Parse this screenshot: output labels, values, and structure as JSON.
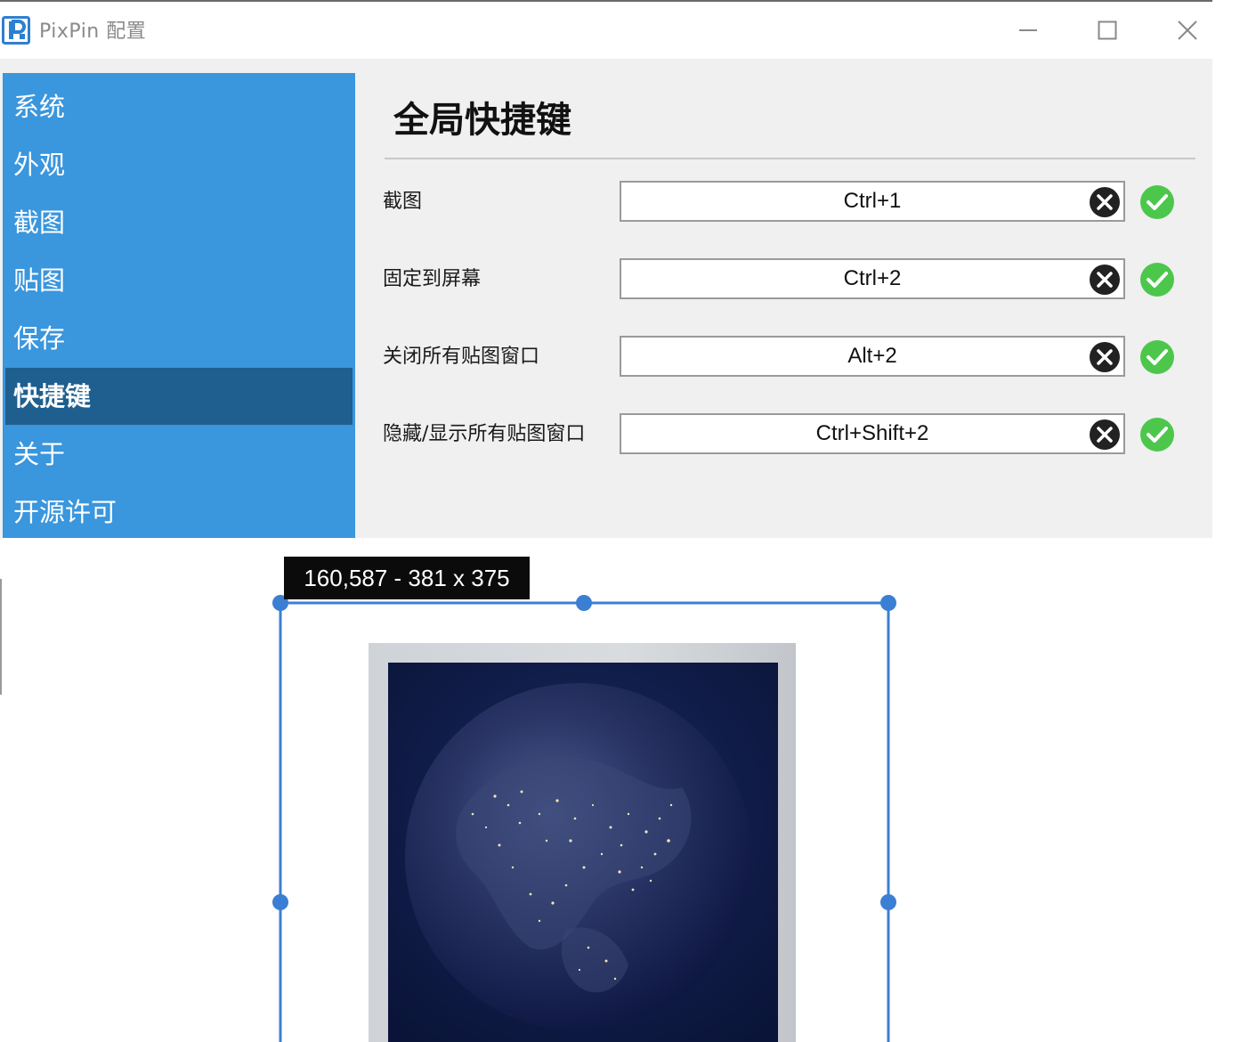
{
  "window": {
    "title": "PixPin 配置",
    "icon": "pixpin-logo-icon",
    "controls": {
      "minimize": "minimize-icon",
      "maximize": "maximize-icon",
      "close": "close-icon"
    }
  },
  "sidebar": {
    "accent_color": "#3a96dd",
    "active_color": "#1e5f8f",
    "items": [
      {
        "label": "系统",
        "active": false
      },
      {
        "label": "外观",
        "active": false
      },
      {
        "label": "截图",
        "active": false
      },
      {
        "label": "贴图",
        "active": false
      },
      {
        "label": "保存",
        "active": false
      },
      {
        "label": "快捷键",
        "active": true
      },
      {
        "label": "关于",
        "active": false
      },
      {
        "label": "开源许可",
        "active": false
      }
    ]
  },
  "content": {
    "title": "全局快捷键",
    "hotkeys": [
      {
        "label": "截图",
        "value": "Ctrl+1",
        "status": "ok"
      },
      {
        "label": "固定到屏幕",
        "value": "Ctrl+2",
        "status": "ok"
      },
      {
        "label": "关闭所有贴图窗口",
        "value": "Alt+2",
        "status": "ok"
      },
      {
        "label": "隐藏/显示所有贴图窗口",
        "value": "Ctrl+Shift+2",
        "status": "ok"
      }
    ],
    "status_color": "#4cc74c"
  },
  "capture": {
    "readout": "160,587 - 381 x 375",
    "selection_color": "#3b7fd4",
    "image_subject": "earth-at-night"
  }
}
